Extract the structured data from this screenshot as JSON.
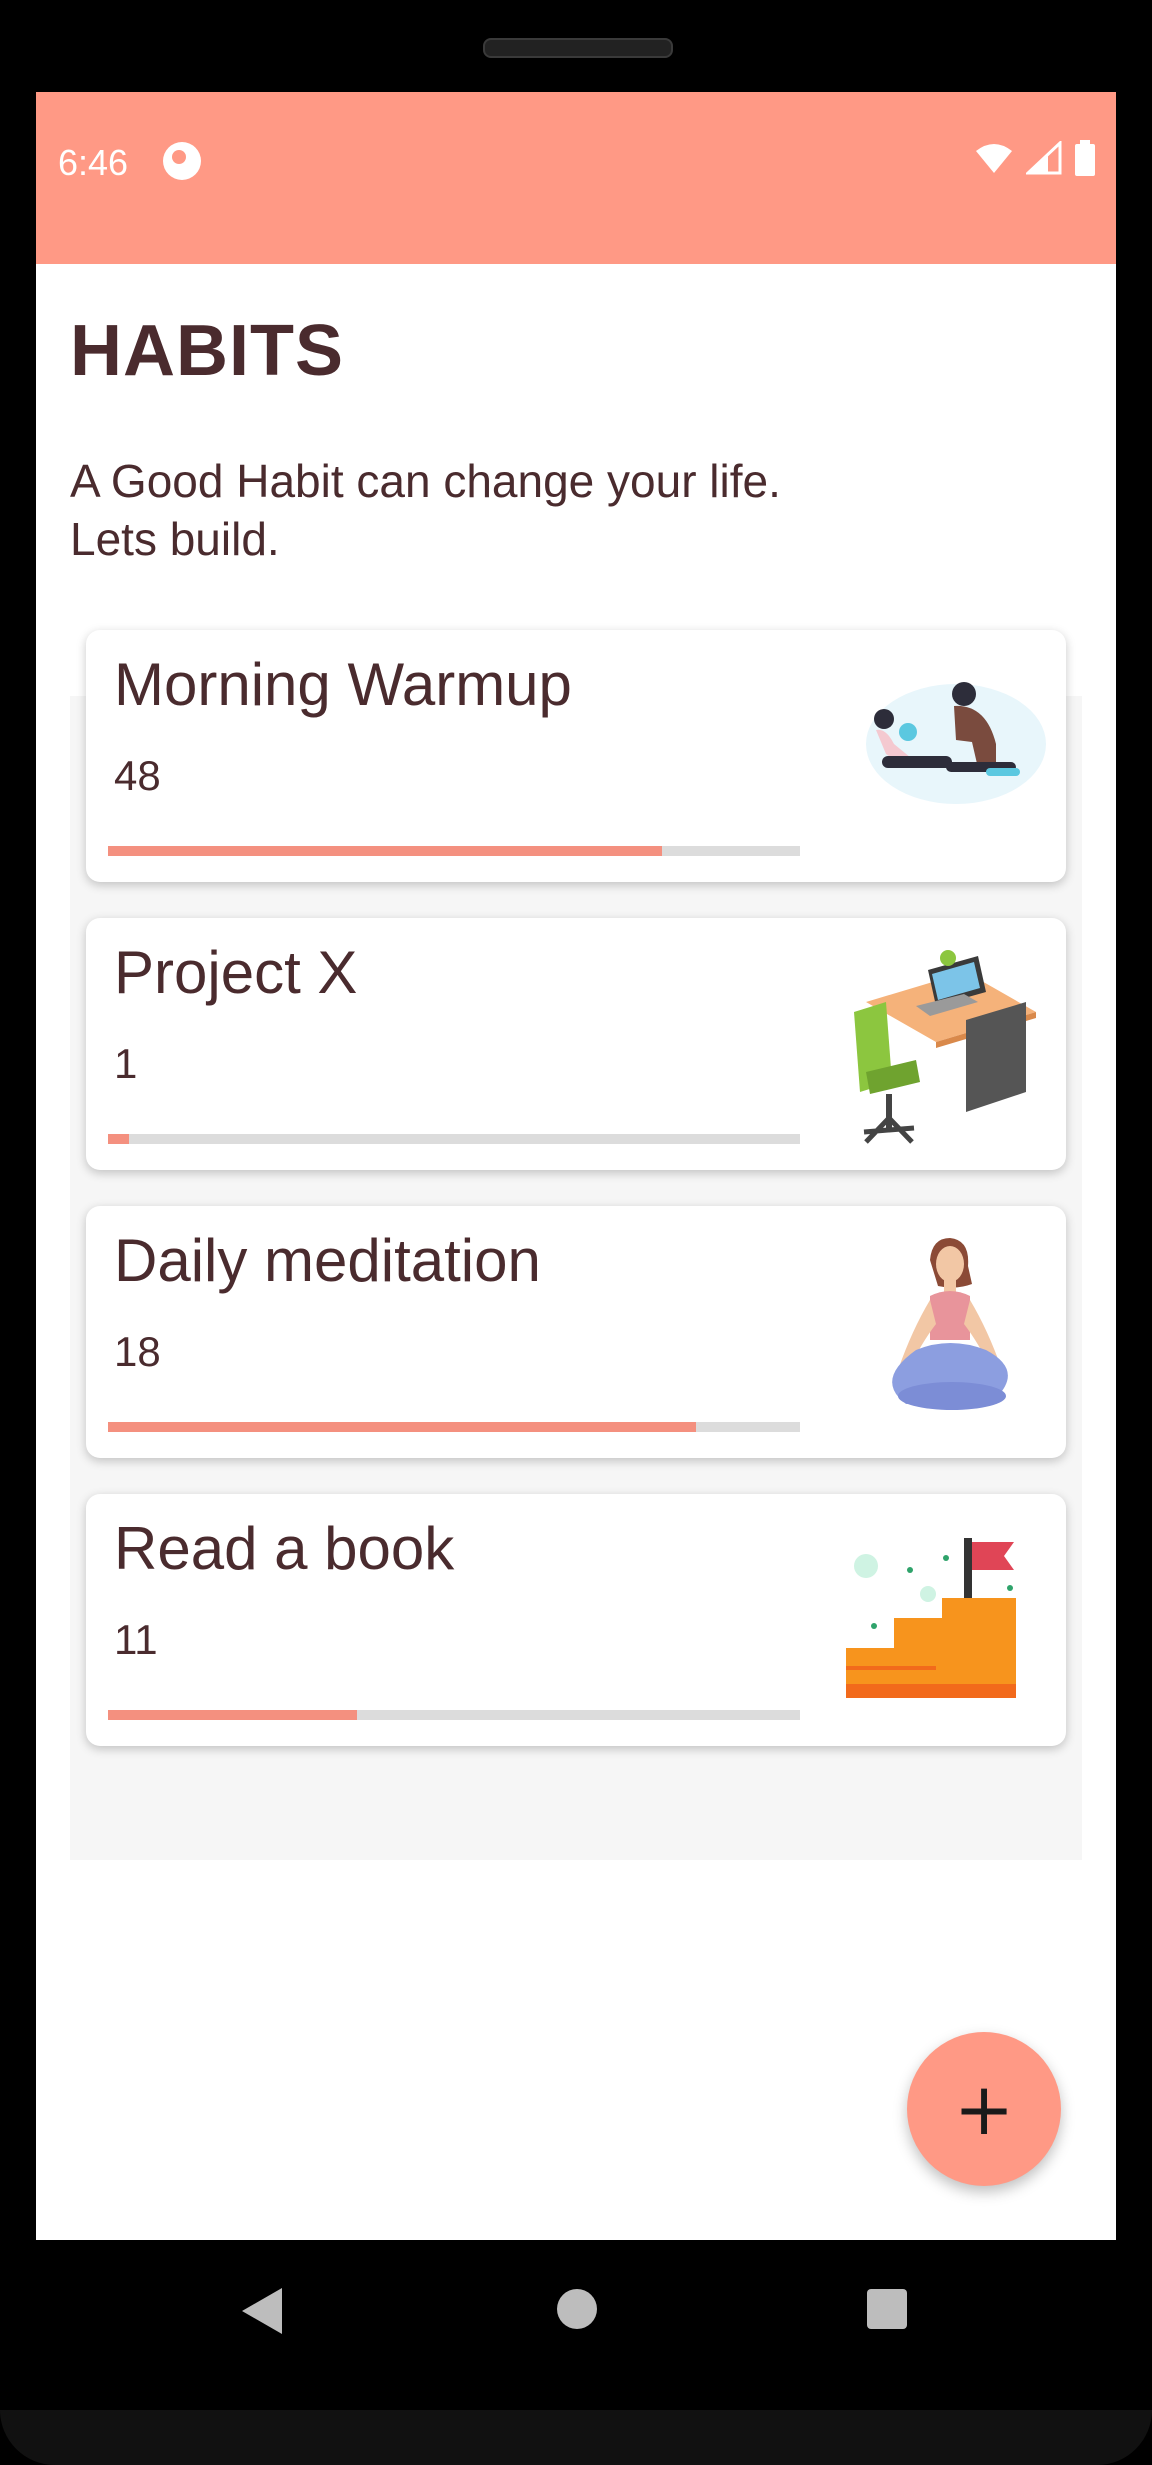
{
  "status_bar": {
    "time": "6:46"
  },
  "header": {
    "title": "HABITS",
    "subtitle_line1": "A Good Habit can change your life.",
    "subtitle_line2": "Lets build."
  },
  "habits": [
    {
      "name": "Morning Warmup",
      "count": "48",
      "progress": 0.8,
      "image": "workout-illustration"
    },
    {
      "name": "Project X",
      "count": "1",
      "progress": 0.03,
      "image": "desk-illustration"
    },
    {
      "name": "Daily meditation",
      "count": "18",
      "progress": 0.85,
      "image": "meditation-illustration"
    },
    {
      "name": "Read a book",
      "count": "11",
      "progress": 0.36,
      "image": "stairs-flag-illustration"
    }
  ],
  "fab": {
    "label": "+"
  },
  "colors": {
    "accent": "#FF9985",
    "progress": "#F4907F",
    "text": "#4A2B2E"
  }
}
